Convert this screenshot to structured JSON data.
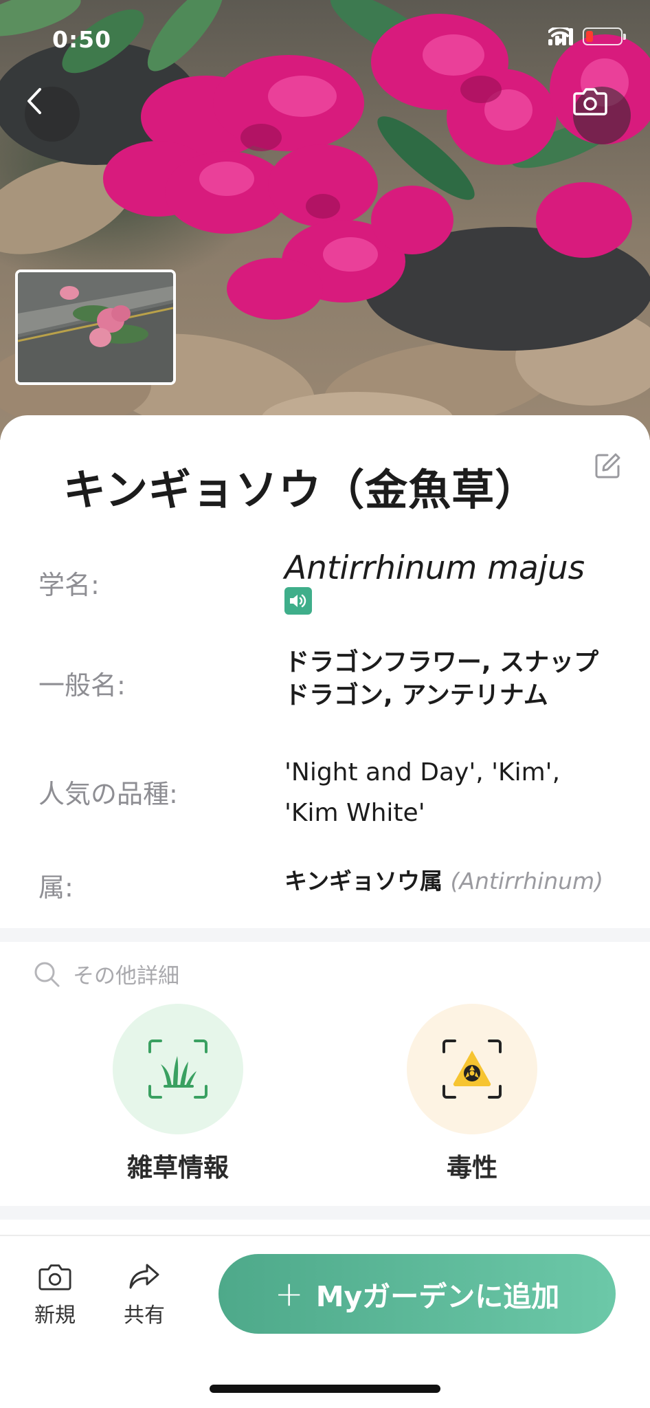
{
  "status_bar": {
    "time": "0:50"
  },
  "header": {
    "back_icon": "chevron-left-icon",
    "camera_icon": "camera-icon"
  },
  "plant": {
    "title": "キンギョソウ（金魚草）",
    "scientific_name_label": "学名:",
    "scientific_name": "Antirrhinum majus",
    "common_name_label": "一般名:",
    "common_names_line1": "ドラゴンフラワー, スナップ",
    "common_names_line2": "ドラゴン, アンテリナム",
    "varieties_label": "人気の品種:",
    "varieties_line1": "'Night and Day', 'Kim',",
    "varieties_line2": "'Kim White'",
    "genus_label": "属:",
    "genus_name": "キンギョソウ属",
    "genus_latin": "(Antirrhinum)"
  },
  "more_details": {
    "label": "その他詳細",
    "features": [
      {
        "label": "雑草情報",
        "icon": "grass-scan-icon",
        "color": "#e6f6ea"
      },
      {
        "label": "毒性",
        "icon": "toxic-warning-icon",
        "color": "#fdf3e3"
      }
    ]
  },
  "bottom_bar": {
    "new_label": "新規",
    "share_label": "共有",
    "add_label": "Myガーデンに追加",
    "add_plus": "+"
  },
  "colors": {
    "accent": "#4ea98a",
    "accent_light": "#6cc8a8",
    "flower": "#d81b7d"
  }
}
